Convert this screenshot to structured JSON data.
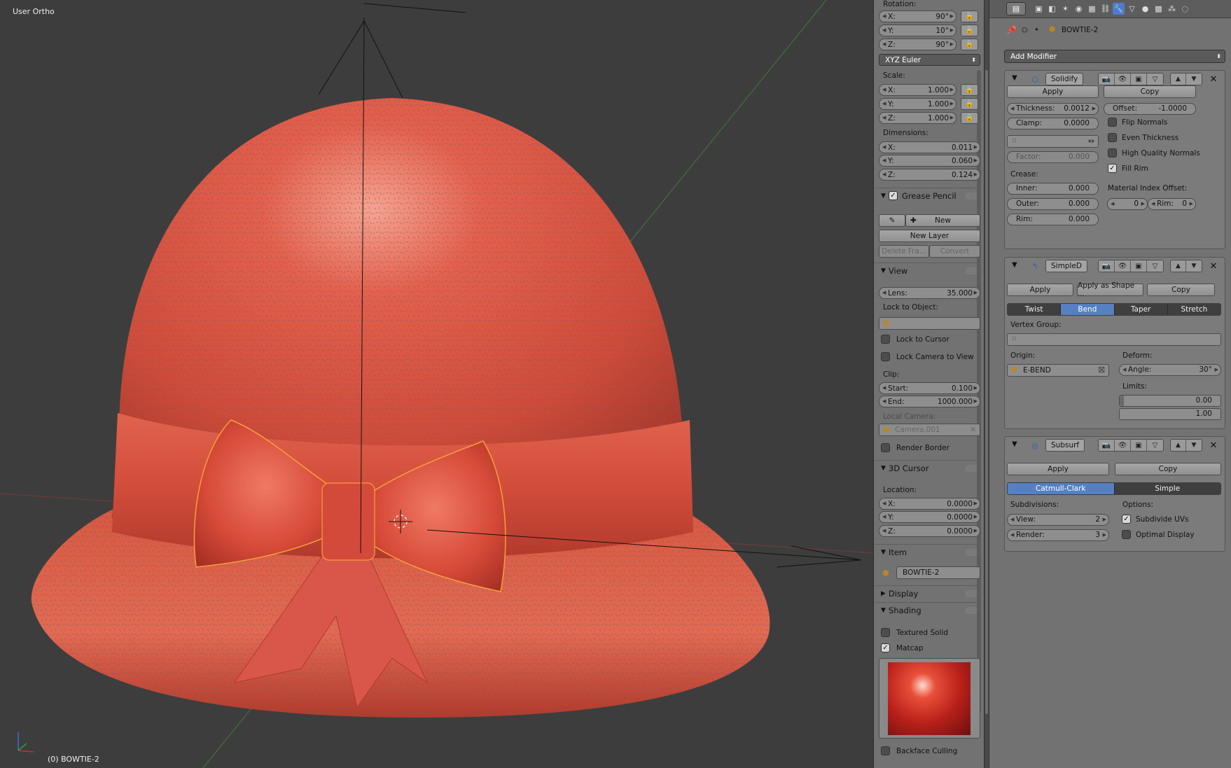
{
  "viewport": {
    "mode_label": "User Ortho",
    "object_label": "(0) BOWTIE-2"
  },
  "npanel": {
    "rotation": {
      "label": "Rotation:",
      "x_label": "X:",
      "x": "90°",
      "y_label": "Y:",
      "y": "10°",
      "z_label": "Z:",
      "z": "90°",
      "mode": "XYZ Euler"
    },
    "scale": {
      "label": "Scale:",
      "x_label": "X:",
      "x": "1.000",
      "y_label": "Y:",
      "y": "1.000",
      "z_label": "Z:",
      "z": "1.000"
    },
    "dimensions": {
      "label": "Dimensions:",
      "x_label": "X:",
      "x": "0.011",
      "y_label": "Y:",
      "y": "0.060",
      "z_label": "Z:",
      "z": "0.124"
    },
    "grease_pencil": {
      "title": "Grease Pencil",
      "enabled": true,
      "new_label": "New",
      "new_layer_label": "New Layer",
      "delete_frame_label": "Delete Fra...",
      "convert_label": "Convert"
    },
    "view": {
      "title": "View",
      "lens_label": "Lens:",
      "lens": "35.000",
      "lock_to_object_label": "Lock to Object:",
      "lock_to_cursor_label": "Lock to Cursor",
      "lock_camera_label": "Lock Camera to View",
      "clip_label": "Clip:",
      "start_label": "Start:",
      "start": "0.100",
      "end_label": "End:",
      "end": "1000.000",
      "local_camera_label": "Local Camera:",
      "local_camera_value": "Camera.001",
      "render_border_label": "Render Border"
    },
    "cursor": {
      "title": "3D Cursor",
      "location_label": "Location:",
      "x_label": "X:",
      "x": "0.0000",
      "y_label": "Y:",
      "y": "0.0000",
      "z_label": "Z:",
      "z": "0.0000"
    },
    "item": {
      "title": "Item",
      "name": "BOWTIE-2"
    },
    "display": {
      "title": "Display"
    },
    "shading": {
      "title": "Shading",
      "textured_solid_label": "Textured Solid",
      "matcap_label": "Matcap",
      "matcap_enabled": true,
      "backface_culling_label": "Backface Culling"
    }
  },
  "properties": {
    "breadcrumb_object": "BOWTIE-2",
    "add_modifier_label": "Add Modifier",
    "solidify": {
      "name": "Solidify",
      "apply_label": "Apply",
      "copy_label": "Copy",
      "thickness_label": "Thickness:",
      "thickness": "0.0012",
      "offset_label": "Offset:",
      "offset": "-1.0000",
      "clamp_label": "Clamp:",
      "clamp": "0.0000",
      "factor_label": "Factor:",
      "factor": "0.000",
      "flip_normals_label": "Flip Normals",
      "even_thickness_label": "Even Thickness",
      "high_quality_normals_label": "High Quality Normals",
      "fill_rim_label": "Fill Rim",
      "fill_rim_enabled": true,
      "crease_label": "Crease:",
      "inner_label": "Inner:",
      "inner": "0.000",
      "outer_label": "Outer:",
      "outer": "0.000",
      "rim_label": "Rim:",
      "rim": "0.000",
      "material_index_label": "Material Index Offset:",
      "mat_index": "0",
      "mat_rim_label": "Rim:",
      "mat_rim": "0"
    },
    "simple_deform": {
      "name": "SimpleD",
      "apply_label": "Apply",
      "apply_shape_label": "Apply as Shape ...",
      "copy_label": "Copy",
      "modes": [
        "Twist",
        "Bend",
        "Taper",
        "Stretch"
      ],
      "selected_mode": "Bend",
      "vertex_group_label": "Vertex Group:",
      "origin_label": "Origin:",
      "origin_value": "E-BEND",
      "deform_label": "Deform:",
      "angle_label": "Angle:",
      "angle": "30°",
      "limits_label": "Limits:",
      "limit_min": "0.00",
      "limit_max": "1.00"
    },
    "subsurf": {
      "name": "Subsurf",
      "apply_label": "Apply",
      "copy_label": "Copy",
      "modes": [
        "Catmull-Clark",
        "Simple"
      ],
      "selected_mode": "Catmull-Clark",
      "subdivisions_label": "Subdivisions:",
      "view_label": "View:",
      "view": "2",
      "render_label": "Render:",
      "render": "3",
      "options_label": "Options:",
      "subdivide_uvs_label": "Subdivide UVs",
      "subdivide_uvs_enabled": true,
      "optimal_display_label": "Optimal Display"
    }
  },
  "colors": {
    "hat": "#d8503f",
    "selection_outline": "#f5a03c",
    "accent": "#5680c2"
  }
}
